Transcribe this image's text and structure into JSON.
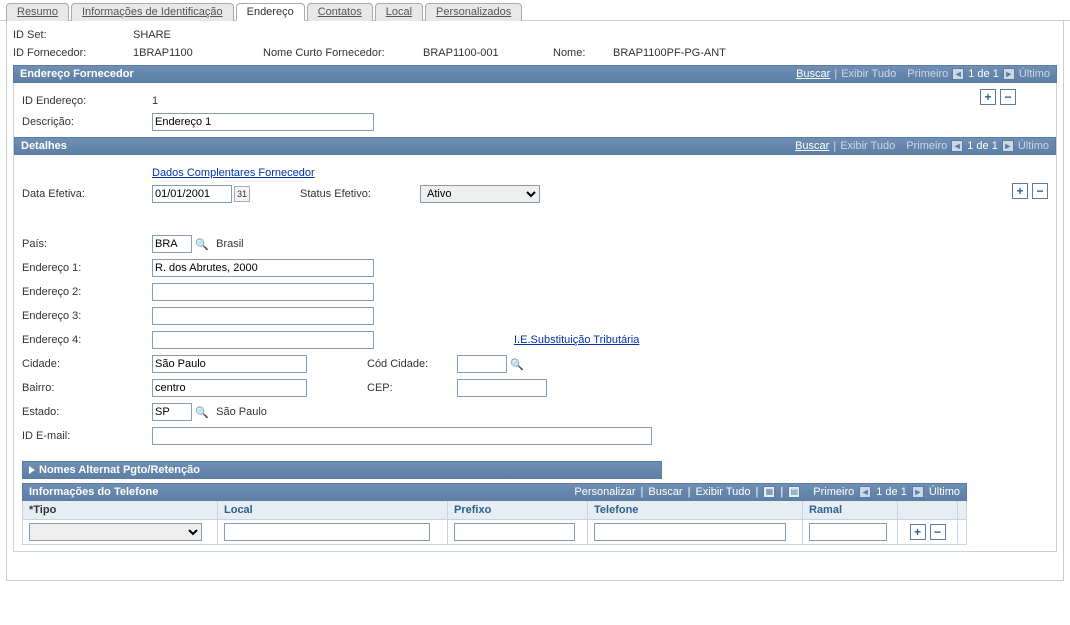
{
  "tabs": {
    "resumo": "Resumo",
    "identificacao": "Informações de Identificação",
    "endereco": "Endereço",
    "contatos": "Contatos",
    "local": "Local",
    "personalizados": "Personalizados"
  },
  "header": {
    "id_set_label": "ID Set:",
    "id_set_value": "SHARE",
    "id_fornecedor_label": "ID Fornecedor:",
    "id_fornecedor_value": "1BRAP1100",
    "nome_curto_label": "Nome Curto Fornecedor:",
    "nome_curto_value": "BRAP1100-001",
    "nome_label": "Nome:",
    "nome_value": "BRAP1100PF-PG-ANT"
  },
  "endereco_section": {
    "title": "Endereço Fornecedor",
    "buscar": "Buscar",
    "exibir_tudo": "Exibir Tudo",
    "primeiro": "Primeiro",
    "pager": "1 de 1",
    "ultimo": "Último",
    "id_endereco_label": "ID Endereço:",
    "id_endereco_value": "1",
    "descricao_label": "Descrição:",
    "descricao_value": "Endereço 1"
  },
  "detalhes": {
    "title": "Detalhes",
    "buscar": "Buscar",
    "exibir_tudo": "Exibir Tudo",
    "primeiro": "Primeiro",
    "pager": "1 de 1",
    "ultimo": "Último",
    "complementares_link": "Dados Complentares Fornecedor",
    "data_efetiva_label": "Data Efetiva:",
    "data_efetiva_value": "01/01/2001",
    "status_label": "Status Efetivo:",
    "status_value": "Ativo",
    "pais_label": "País:",
    "pais_value": "BRA",
    "pais_desc": "Brasil",
    "end1_label": "Endereço 1:",
    "end1_value": "R. dos Abrutes, 2000",
    "end2_label": "Endereço 2:",
    "end2_value": "",
    "end3_label": "Endereço 3:",
    "end3_value": "",
    "end4_label": "Endereço 4:",
    "end4_value": "",
    "ie_link": "I.E.Substituição Tributária",
    "cidade_label": "Cidade:",
    "cidade_value": "São Paulo",
    "cod_cidade_label": "Cód Cidade:",
    "cod_cidade_value": "",
    "bairro_label": "Bairro:",
    "bairro_value": "centro",
    "cep_label": "CEP:",
    "cep_value": "",
    "estado_label": "Estado:",
    "estado_value": "SP",
    "estado_desc": "São Paulo",
    "email_label": "ID E-mail:",
    "email_value": ""
  },
  "nomes_alternat": {
    "title": "Nomes Alternat Pgto/Retenção"
  },
  "telefone": {
    "title": "Informações do Telefone",
    "personalizar": "Personalizar",
    "buscar": "Buscar",
    "exibir_tudo": "Exibir Tudo",
    "primeiro": "Primeiro",
    "pager": "1 de 1",
    "ultimo": "Último",
    "col_tipo": "*Tipo",
    "col_local": "Local",
    "col_prefixo": "Prefixo",
    "col_telefone": "Telefone",
    "col_ramal": "Ramal"
  }
}
